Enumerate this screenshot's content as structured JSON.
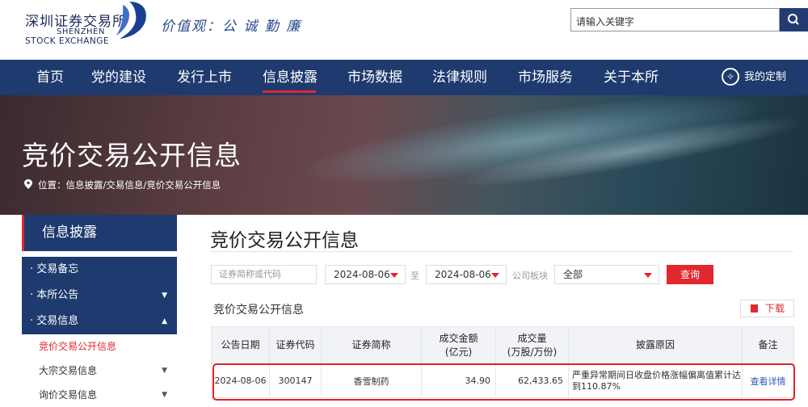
{
  "header": {
    "logo_cn": "深圳证券交易所",
    "logo_en1": "SHENZHEN",
    "logo_en2": "STOCK EXCHANGE",
    "slogan": "价值观：公 诚 勤 廉",
    "search_placeholder": "请输入关键字",
    "search_icon": "search-icon"
  },
  "nav": {
    "items": [
      "首页",
      "党的建设",
      "发行上市",
      "信息披露",
      "市场数据",
      "法律规则",
      "市场服务",
      "关于本所"
    ],
    "active_index": 3,
    "custom_label": "我的定制",
    "custom_icon": "star-circle-icon"
  },
  "banner": {
    "title": "竞价交易公开信息",
    "breadcrumb": "位置：信息披露/交易信息/竞价交易公开信息",
    "pin_icon": "location-pin-icon"
  },
  "sidebar": {
    "title": "信息披露",
    "items": [
      {
        "label": "交易备忘",
        "expandable": false
      },
      {
        "label": "本所公告",
        "expandable": true,
        "expanded": false
      },
      {
        "label": "交易信息",
        "expandable": true,
        "expanded": true
      }
    ],
    "subitems": [
      {
        "label": "竞价交易公开信息",
        "active": true
      },
      {
        "label": "大宗交易信息",
        "expandable": true
      },
      {
        "label": "询价交易信息",
        "expandable": true
      }
    ]
  },
  "main": {
    "title": "竞价交易公开信息",
    "filters": {
      "code_placeholder": "证券简称或代码",
      "start_date": "2024-08-06",
      "to_label": "至",
      "end_date": "2024-08-06",
      "board_label": "公司板块",
      "board_value": "全部",
      "query_label": "查询"
    },
    "subtitle": "竞价交易公开信息",
    "download_label": "下载",
    "table": {
      "headers": [
        "公告日期",
        "证券代码",
        "证券简称",
        "成交金额\n(亿元)",
        "成交量\n(万股/万份)",
        "披露原因",
        "备注"
      ],
      "rows": [
        {
          "date": "2024-08-06",
          "code": "300147",
          "name": "香雪制药",
          "amount": "34.90",
          "volume": "62,433.65",
          "reason": "严重异常期间日收盘价格涨幅偏离值累计达到110.87%",
          "note": "查看详情"
        }
      ]
    }
  },
  "colors": {
    "navy": "#1e3a6e",
    "red": "#e0282e",
    "link": "#2a5bb5"
  }
}
